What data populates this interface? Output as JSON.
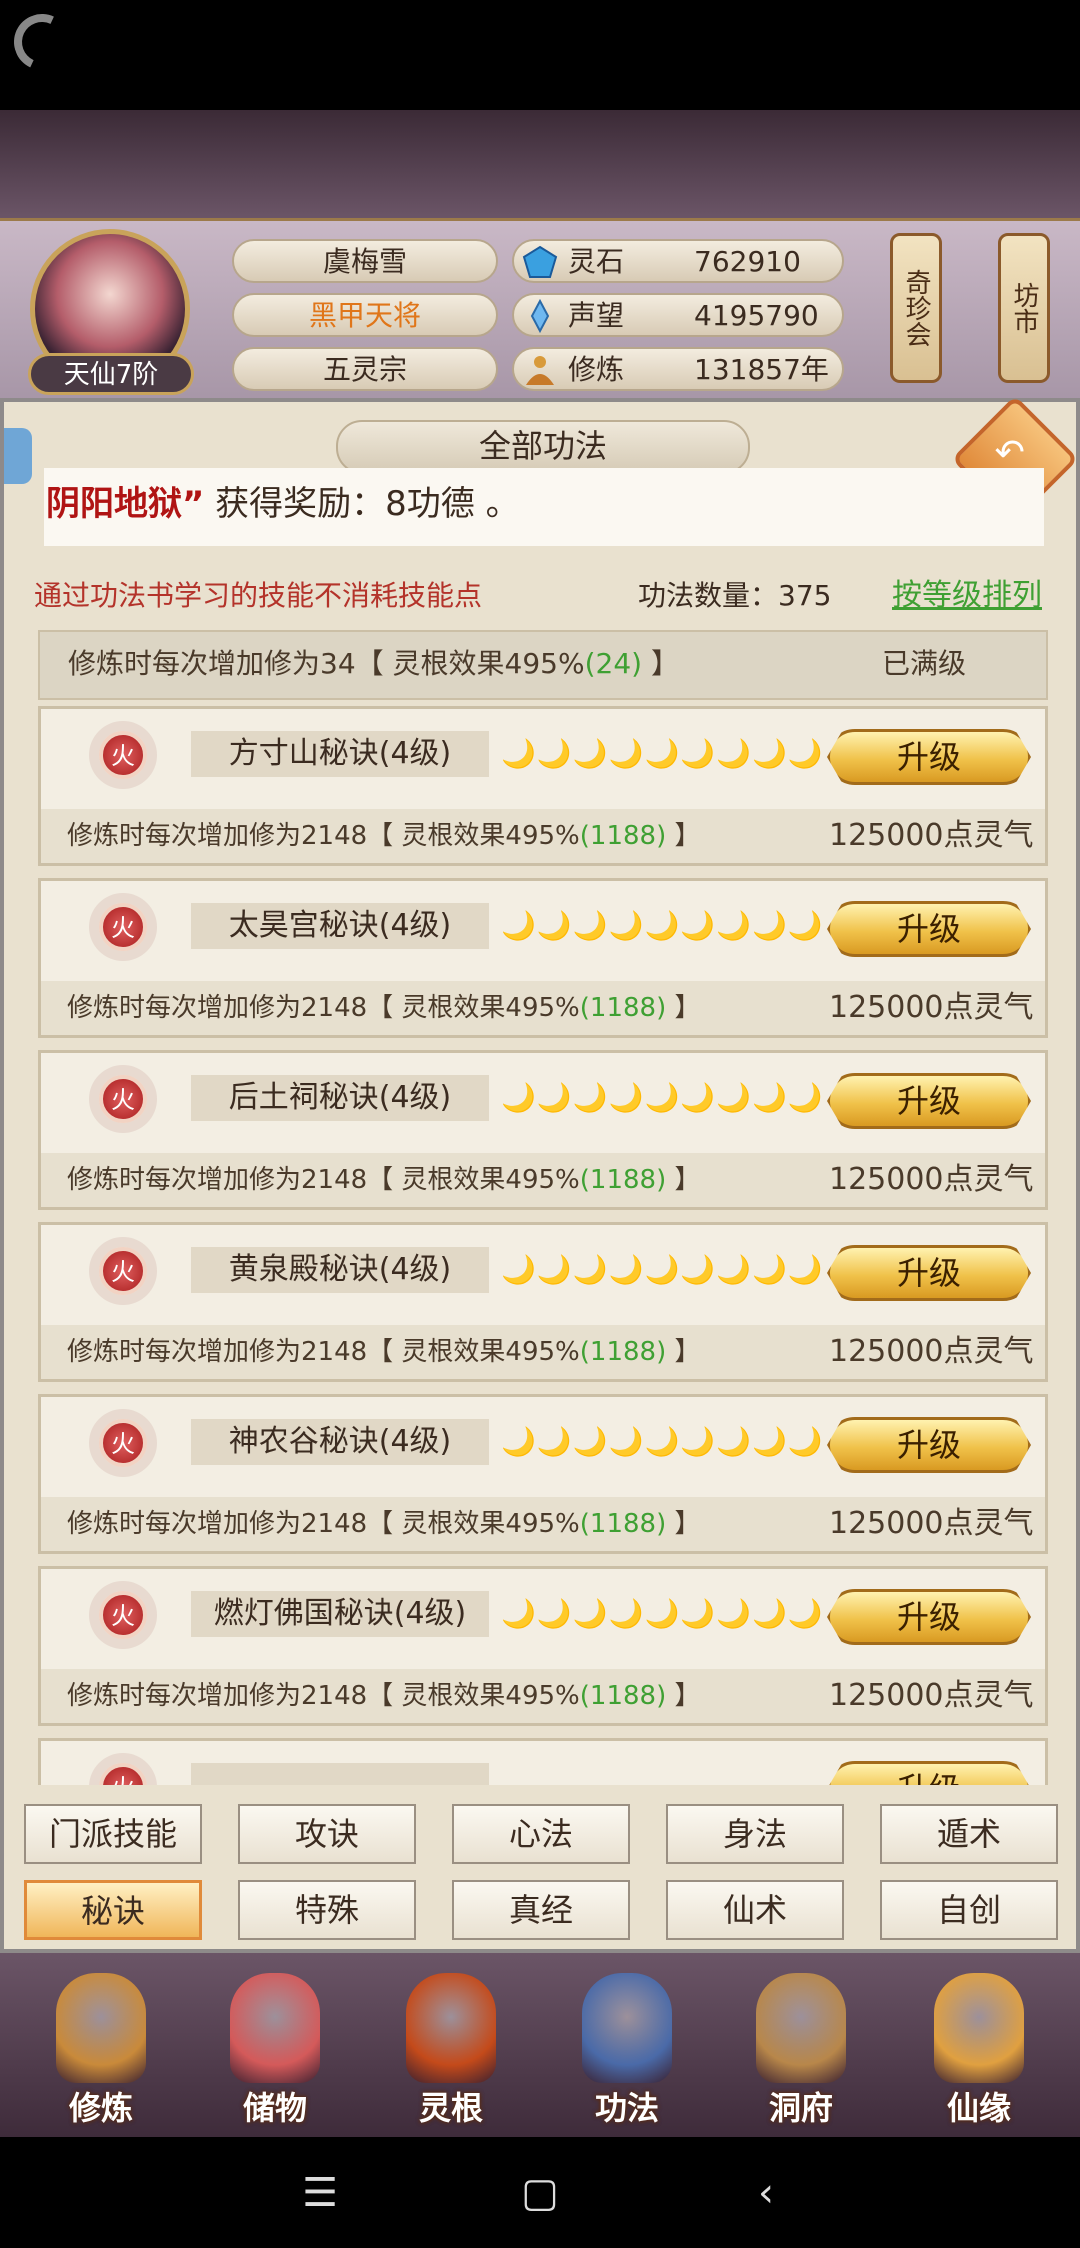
{
  "header": {
    "player_name": "虞梅雪",
    "title": "黑甲天将",
    "sect": "五灵宗",
    "rank": "天仙7阶",
    "stats": [
      {
        "label": "灵石",
        "value": "762910",
        "icon": "spirit-stone-icon"
      },
      {
        "label": "声望",
        "value": "4195790",
        "icon": "reputation-icon"
      },
      {
        "label": "修炼",
        "value": "131857年",
        "icon": "cultivation-icon"
      }
    ],
    "side_buttons": [
      "奇珍会",
      "坊市"
    ]
  },
  "panel": {
    "title": "全部功法",
    "notice_highlight": "阴阳地狱”",
    "notice_text": "获得奖励：8功德 。",
    "hint": "通过功法书学习的技能不消耗技能点",
    "count_label": "功法数量：375",
    "sort_link": "按等级排列"
  },
  "partial_row": {
    "desc_pre": "修炼时每次增加修为34【 灵根效果495%",
    "desc_green": "(24)",
    "desc_post": " 】",
    "status": "已满级"
  },
  "skills": [
    {
      "element": "火",
      "name": "方寸山秘诀(4级)",
      "moons": "🌙🌙🌙🌙🌙🌙🌙🌙🌙",
      "button": "升级",
      "desc_pre": "修炼时每次增加修为2148【 灵根效果495%",
      "desc_green": "(1188)",
      "desc_post": " 】",
      "cost": "125000点灵气"
    },
    {
      "element": "火",
      "name": "太昊宫秘诀(4级)",
      "moons": "🌙🌙🌙🌙🌙🌙🌙🌙🌙",
      "button": "升级",
      "desc_pre": "修炼时每次增加修为2148【 灵根效果495%",
      "desc_green": "(1188)",
      "desc_post": " 】",
      "cost": "125000点灵气"
    },
    {
      "element": "火",
      "name": "后土祠秘诀(4级)",
      "moons": "🌙🌙🌙🌙🌙🌙🌙🌙🌙",
      "button": "升级",
      "desc_pre": "修炼时每次增加修为2148【 灵根效果495%",
      "desc_green": "(1188)",
      "desc_post": " 】",
      "cost": "125000点灵气"
    },
    {
      "element": "火",
      "name": "黄泉殿秘诀(4级)",
      "moons": "🌙🌙🌙🌙🌙🌙🌙🌙🌙",
      "button": "升级",
      "desc_pre": "修炼时每次增加修为2148【 灵根效果495%",
      "desc_green": "(1188)",
      "desc_post": " 】",
      "cost": "125000点灵气"
    },
    {
      "element": "火",
      "name": "神农谷秘诀(4级)",
      "moons": "🌙🌙🌙🌙🌙🌙🌙🌙🌙",
      "button": "升级",
      "desc_pre": "修炼时每次增加修为2148【 灵根效果495%",
      "desc_green": "(1188)",
      "desc_post": " 】",
      "cost": "125000点灵气"
    },
    {
      "element": "火",
      "name": "燃灯佛国秘诀(4级)",
      "moons": "🌙🌙🌙🌙🌙🌙🌙🌙🌙",
      "button": "升级",
      "desc_pre": "修炼时每次增加修为2148【 灵根效果495%",
      "desc_green": "(1188)",
      "desc_post": " 】",
      "cost": "125000点灵气"
    },
    {
      "element": "火",
      "name": "",
      "moons": "",
      "button": "升级",
      "desc_pre": "",
      "desc_green": "",
      "desc_post": "",
      "cost": ""
    }
  ],
  "tabs": [
    {
      "label": "门派技能",
      "active": false
    },
    {
      "label": "攻诀",
      "active": false
    },
    {
      "label": "心法",
      "active": false
    },
    {
      "label": "身法",
      "active": false
    },
    {
      "label": "遁术",
      "active": false
    },
    {
      "label": "秘诀",
      "active": true
    },
    {
      "label": "特殊",
      "active": false
    },
    {
      "label": "真经",
      "active": false
    },
    {
      "label": "仙术",
      "active": false
    },
    {
      "label": "自创",
      "active": false
    }
  ],
  "bottom_nav": [
    {
      "label": "修炼",
      "color": "#c98a3a"
    },
    {
      "label": "储物",
      "color": "#d45a5a"
    },
    {
      "label": "灵根",
      "color": "#c44a1a"
    },
    {
      "label": "功法",
      "color": "#4a6aa8"
    },
    {
      "label": "洞府",
      "color": "#b8874a"
    },
    {
      "label": "仙缘",
      "color": "#e0a040"
    }
  ],
  "system_nav": [
    "☰",
    "▢",
    "‹"
  ]
}
